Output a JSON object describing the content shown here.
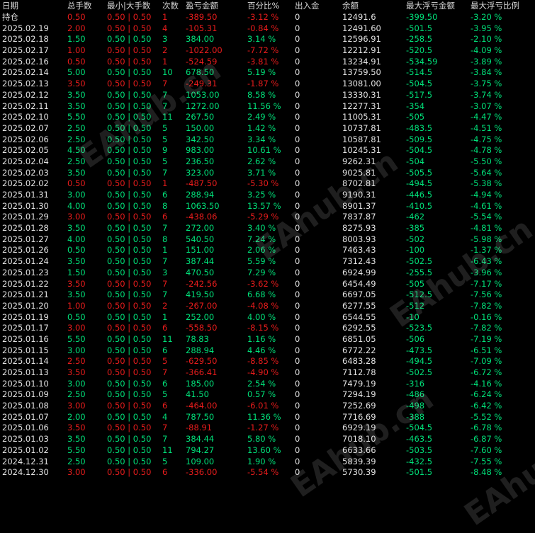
{
  "headers": [
    "日期",
    "总手数",
    "最小|大手数",
    "次数",
    "盈亏金额",
    "百分比%",
    "出入金",
    "余额",
    "最大浮亏金额",
    "最大浮亏比例"
  ],
  "watermark": "EAhub.cn",
  "holding_row": {
    "label": "持仓",
    "lots": "0.50",
    "minmax": "0.50 | 0.50",
    "count": "1",
    "pnl": "-389.50",
    "pct": "-3.12 %",
    "deposit": "0",
    "balance": "12491.6",
    "max_dd": "-399.50",
    "max_dd_pct": "-3.20 %"
  },
  "rows": [
    {
      "date": "2025.02.19",
      "lots": "2.00",
      "minmax": "0.50 | 0.50",
      "count": "4",
      "pnl": "-105.31",
      "pct": "-0.84 %",
      "deposit": "0",
      "balance": "12491.60",
      "max_dd": "-501.5",
      "max_dd_pct": "-3.95 %"
    },
    {
      "date": "2025.02.18",
      "lots": "1.50",
      "minmax": "0.50 | 0.50",
      "count": "3",
      "pnl": "384.00",
      "pct": "3.14 %",
      "deposit": "0",
      "balance": "12596.91",
      "max_dd": "-258.5",
      "max_dd_pct": "-2.10 %"
    },
    {
      "date": "2025.02.17",
      "lots": "1.00",
      "minmax": "0.50 | 0.50",
      "count": "2",
      "pnl": "-1022.00",
      "pct": "-7.72 %",
      "deposit": "0",
      "balance": "12212.91",
      "max_dd": "-520.5",
      "max_dd_pct": "-4.09 %"
    },
    {
      "date": "2025.02.16",
      "lots": "0.50",
      "minmax": "0.50 | 0.50",
      "count": "1",
      "pnl": "-524.59",
      "pct": "-3.81 %",
      "deposit": "0",
      "balance": "13234.91",
      "max_dd": "-534.59",
      "max_dd_pct": "-3.89 %"
    },
    {
      "date": "2025.02.14",
      "lots": "5.00",
      "minmax": "0.50 | 0.50",
      "count": "10",
      "pnl": "678.50",
      "pct": "5.19 %",
      "deposit": "0",
      "balance": "13759.50",
      "max_dd": "-514.5",
      "max_dd_pct": "-3.84 %"
    },
    {
      "date": "2025.02.13",
      "lots": "3.50",
      "minmax": "0.50 | 0.50",
      "count": "7",
      "pnl": "-249.31",
      "pct": "-1.87 %",
      "deposit": "0",
      "balance": "13081.00",
      "max_dd": "-504.5",
      "max_dd_pct": "-3.75 %"
    },
    {
      "date": "2025.02.12",
      "lots": "3.50",
      "minmax": "0.50 | 0.50",
      "count": "7",
      "pnl": "1053.00",
      "pct": "8.58 %",
      "deposit": "0",
      "balance": "13330.31",
      "max_dd": "-517.5",
      "max_dd_pct": "-3.74 %"
    },
    {
      "date": "2025.02.11",
      "lots": "3.50",
      "minmax": "0.50 | 0.50",
      "count": "7",
      "pnl": "1272.00",
      "pct": "11.56 %",
      "deposit": "0",
      "balance": "12277.31",
      "max_dd": "-354",
      "max_dd_pct": "-3.07 %"
    },
    {
      "date": "2025.02.10",
      "lots": "5.50",
      "minmax": "0.50 | 0.50",
      "count": "11",
      "pnl": "267.50",
      "pct": "2.49 %",
      "deposit": "0",
      "balance": "11005.31",
      "max_dd": "-505",
      "max_dd_pct": "-4.47 %"
    },
    {
      "date": "2025.02.07",
      "lots": "2.50",
      "minmax": "0.50 | 0.50",
      "count": "5",
      "pnl": "150.00",
      "pct": "1.42 %",
      "deposit": "0",
      "balance": "10737.81",
      "max_dd": "-483.5",
      "max_dd_pct": "-4.51 %"
    },
    {
      "date": "2025.02.06",
      "lots": "2.50",
      "minmax": "0.50 | 0.50",
      "count": "5",
      "pnl": "342.50",
      "pct": "3.34 %",
      "deposit": "0",
      "balance": "10587.81",
      "max_dd": "-509.5",
      "max_dd_pct": "-4.75 %"
    },
    {
      "date": "2025.02.05",
      "lots": "4.50",
      "minmax": "0.50 | 0.50",
      "count": "9",
      "pnl": "983.00",
      "pct": "10.61 %",
      "deposit": "0",
      "balance": "10245.31",
      "max_dd": "-504.5",
      "max_dd_pct": "-4.78 %"
    },
    {
      "date": "2025.02.04",
      "lots": "2.50",
      "minmax": "0.50 | 0.50",
      "count": "5",
      "pnl": "236.50",
      "pct": "2.62 %",
      "deposit": "0",
      "balance": "9262.31",
      "max_dd": "-504",
      "max_dd_pct": "-5.50 %"
    },
    {
      "date": "2025.02.03",
      "lots": "3.50",
      "minmax": "0.50 | 0.50",
      "count": "7",
      "pnl": "323.00",
      "pct": "3.71 %",
      "deposit": "0",
      "balance": "9025.81",
      "max_dd": "-505.5",
      "max_dd_pct": "-5.64 %"
    },
    {
      "date": "2025.02.02",
      "lots": "0.50",
      "minmax": "0.50 | 0.50",
      "count": "1",
      "pnl": "-487.50",
      "pct": "-5.30 %",
      "deposit": "0",
      "balance": "8702.81",
      "max_dd": "-494.5",
      "max_dd_pct": "-5.38 %"
    },
    {
      "date": "2025.01.31",
      "lots": "3.00",
      "minmax": "0.50 | 0.50",
      "count": "6",
      "pnl": "288.94",
      "pct": "3.25 %",
      "deposit": "0",
      "balance": "9190.31",
      "max_dd": "-446.5",
      "max_dd_pct": "-4.94 %"
    },
    {
      "date": "2025.01.30",
      "lots": "4.00",
      "minmax": "0.50 | 0.50",
      "count": "8",
      "pnl": "1063.50",
      "pct": "13.57 %",
      "deposit": "0",
      "balance": "8901.37",
      "max_dd": "-410.5",
      "max_dd_pct": "-4.61 %"
    },
    {
      "date": "2025.01.29",
      "lots": "3.00",
      "minmax": "0.50 | 0.50",
      "count": "6",
      "pnl": "-438.06",
      "pct": "-5.29 %",
      "deposit": "0",
      "balance": "7837.87",
      "max_dd": "-462",
      "max_dd_pct": "-5.54 %"
    },
    {
      "date": "2025.01.28",
      "lots": "3.50",
      "minmax": "0.50 | 0.50",
      "count": "7",
      "pnl": "272.00",
      "pct": "3.40 %",
      "deposit": "0",
      "balance": "8275.93",
      "max_dd": "-385",
      "max_dd_pct": "-4.81 %"
    },
    {
      "date": "2025.01.27",
      "lots": "4.00",
      "minmax": "0.50 | 0.50",
      "count": "8",
      "pnl": "540.50",
      "pct": "7.24 %",
      "deposit": "0",
      "balance": "8003.93",
      "max_dd": "-502",
      "max_dd_pct": "-5.98 %"
    },
    {
      "date": "2025.01.26",
      "lots": "0.50",
      "minmax": "0.50 | 0.50",
      "count": "1",
      "pnl": "151.00",
      "pct": "2.06 %",
      "deposit": "0",
      "balance": "7463.43",
      "max_dd": "-100",
      "max_dd_pct": "-1.37 %"
    },
    {
      "date": "2025.01.24",
      "lots": "3.50",
      "minmax": "0.50 | 0.50",
      "count": "7",
      "pnl": "387.44",
      "pct": "5.59 %",
      "deposit": "0",
      "balance": "7312.43",
      "max_dd": "-502.5",
      "max_dd_pct": "-6.43 %"
    },
    {
      "date": "2025.01.23",
      "lots": "1.50",
      "minmax": "0.50 | 0.50",
      "count": "3",
      "pnl": "470.50",
      "pct": "7.29 %",
      "deposit": "0",
      "balance": "6924.99",
      "max_dd": "-255.5",
      "max_dd_pct": "-3.96 %"
    },
    {
      "date": "2025.01.22",
      "lots": "3.50",
      "minmax": "0.50 | 0.50",
      "count": "7",
      "pnl": "-242.56",
      "pct": "-3.62 %",
      "deposit": "0",
      "balance": "6454.49",
      "max_dd": "-505",
      "max_dd_pct": "-7.17 %"
    },
    {
      "date": "2025.01.21",
      "lots": "3.50",
      "minmax": "0.50 | 0.50",
      "count": "7",
      "pnl": "419.50",
      "pct": "6.68 %",
      "deposit": "0",
      "balance": "6697.05",
      "max_dd": "-512.5",
      "max_dd_pct": "-7.56 %"
    },
    {
      "date": "2025.01.20",
      "lots": "1.00",
      "minmax": "0.50 | 0.50",
      "count": "2",
      "pnl": "-267.00",
      "pct": "-4.08 %",
      "deposit": "0",
      "balance": "6277.55",
      "max_dd": "-512",
      "max_dd_pct": "-7.82 %"
    },
    {
      "date": "2025.01.19",
      "lots": "0.50",
      "minmax": "0.50 | 0.50",
      "count": "1",
      "pnl": "252.00",
      "pct": "4.00 %",
      "deposit": "0",
      "balance": "6544.55",
      "max_dd": "-10",
      "max_dd_pct": "-0.16 %"
    },
    {
      "date": "2025.01.17",
      "lots": "3.00",
      "minmax": "0.50 | 0.50",
      "count": "6",
      "pnl": "-558.50",
      "pct": "-8.15 %",
      "deposit": "0",
      "balance": "6292.55",
      "max_dd": "-523.5",
      "max_dd_pct": "-7.82 %"
    },
    {
      "date": "2025.01.16",
      "lots": "5.50",
      "minmax": "0.50 | 0.50",
      "count": "11",
      "pnl": "78.83",
      "pct": "1.16 %",
      "deposit": "0",
      "balance": "6851.05",
      "max_dd": "-506",
      "max_dd_pct": "-7.19 %"
    },
    {
      "date": "2025.01.15",
      "lots": "3.00",
      "minmax": "0.50 | 0.50",
      "count": "6",
      "pnl": "288.94",
      "pct": "4.46 %",
      "deposit": "0",
      "balance": "6772.22",
      "max_dd": "-473.5",
      "max_dd_pct": "-6.51 %"
    },
    {
      "date": "2025.01.14",
      "lots": "2.50",
      "minmax": "0.50 | 0.50",
      "count": "5",
      "pnl": "-629.50",
      "pct": "-8.85 %",
      "deposit": "0",
      "balance": "6483.28",
      "max_dd": "-494.5",
      "max_dd_pct": "-7.09 %"
    },
    {
      "date": "2025.01.13",
      "lots": "3.50",
      "minmax": "0.50 | 0.50",
      "count": "7",
      "pnl": "-366.41",
      "pct": "-4.90 %",
      "deposit": "0",
      "balance": "7112.78",
      "max_dd": "-502.5",
      "max_dd_pct": "-6.72 %"
    },
    {
      "date": "2025.01.10",
      "lots": "3.00",
      "minmax": "0.50 | 0.50",
      "count": "6",
      "pnl": "185.00",
      "pct": "2.54 %",
      "deposit": "0",
      "balance": "7479.19",
      "max_dd": "-316",
      "max_dd_pct": "-4.16 %"
    },
    {
      "date": "2025.01.09",
      "lots": "2.50",
      "minmax": "0.50 | 0.50",
      "count": "5",
      "pnl": "41.50",
      "pct": "0.57 %",
      "deposit": "0",
      "balance": "7294.19",
      "max_dd": "-486",
      "max_dd_pct": "-6.24 %"
    },
    {
      "date": "2025.01.08",
      "lots": "3.00",
      "minmax": "0.50 | 0.50",
      "count": "6",
      "pnl": "-464.00",
      "pct": "-6.01 %",
      "deposit": "0",
      "balance": "7252.69",
      "max_dd": "-498",
      "max_dd_pct": "-6.42 %"
    },
    {
      "date": "2025.01.07",
      "lots": "2.00",
      "minmax": "0.50 | 0.50",
      "count": "4",
      "pnl": "787.50",
      "pct": "11.36 %",
      "deposit": "0",
      "balance": "7716.69",
      "max_dd": "-388",
      "max_dd_pct": "-5.52 %"
    },
    {
      "date": "2025.01.06",
      "lots": "3.50",
      "minmax": "0.50 | 0.50",
      "count": "7",
      "pnl": "-88.91",
      "pct": "-1.27 %",
      "deposit": "0",
      "balance": "6929.19",
      "max_dd": "-504.5",
      "max_dd_pct": "-6.78 %"
    },
    {
      "date": "2025.01.03",
      "lots": "3.50",
      "minmax": "0.50 | 0.50",
      "count": "7",
      "pnl": "384.44",
      "pct": "5.80 %",
      "deposit": "0",
      "balance": "7018.10",
      "max_dd": "-463.5",
      "max_dd_pct": "-6.87 %"
    },
    {
      "date": "2025.01.02",
      "lots": "5.50",
      "minmax": "0.50 | 0.50",
      "count": "11",
      "pnl": "794.27",
      "pct": "13.60 %",
      "deposit": "0",
      "balance": "6633.66",
      "max_dd": "-503.5",
      "max_dd_pct": "-7.60 %"
    },
    {
      "date": "2024.12.31",
      "lots": "2.50",
      "minmax": "0.50 | 0.50",
      "count": "5",
      "pnl": "109.00",
      "pct": "1.90 %",
      "deposit": "0",
      "balance": "5839.39",
      "max_dd": "-432.5",
      "max_dd_pct": "-7.55 %"
    },
    {
      "date": "2024.12.30",
      "lots": "3.00",
      "minmax": "0.50 | 0.50",
      "count": "6",
      "pnl": "-336.00",
      "pct": "-5.54 %",
      "deposit": "0",
      "balance": "5730.39",
      "max_dd": "-501.5",
      "max_dd_pct": "-8.48 %"
    }
  ]
}
